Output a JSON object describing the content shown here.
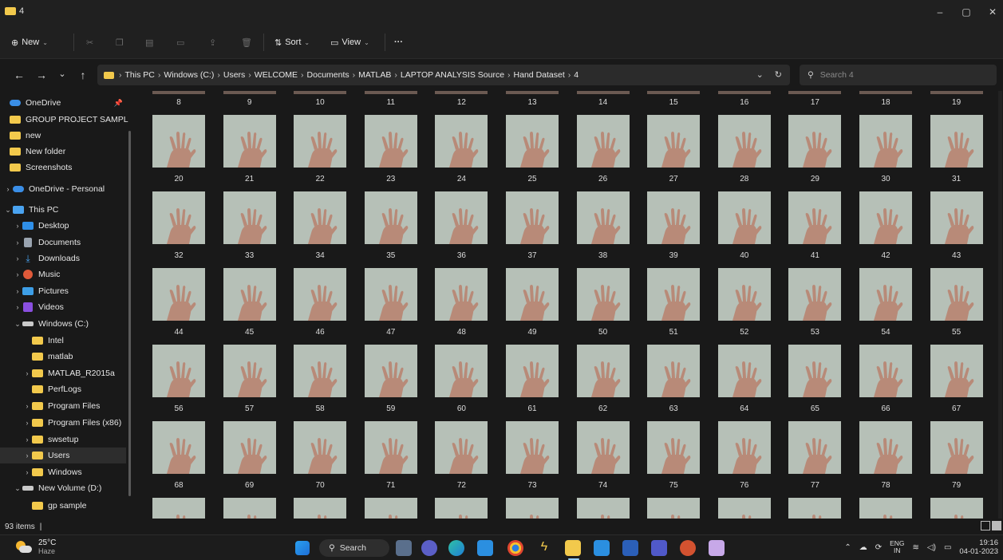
{
  "window": {
    "title": "4",
    "controls": {
      "minimize": "–",
      "restore": "▢",
      "close": "✕"
    }
  },
  "toolbar": {
    "new_label": "New",
    "sort_label": "Sort",
    "view_label": "View",
    "more_label": "···"
  },
  "address": {
    "crumbs": [
      "This PC",
      "Windows (C:)",
      "Users",
      "WELCOME",
      "Documents",
      "MATLAB",
      "LAPTOP ANALYSIS Source",
      "Hand Dataset",
      "4"
    ],
    "separator": "›"
  },
  "search": {
    "placeholder": "Search 4"
  },
  "sidebar": {
    "items": [
      {
        "label": "OneDrive",
        "icon": "cloud-icon",
        "indent": 0,
        "chevron": "",
        "pinned": true
      },
      {
        "label": "GROUP PROJECT SAMPL",
        "icon": "folder-icon",
        "indent": 0,
        "chevron": ""
      },
      {
        "label": "new",
        "icon": "folder-icon",
        "indent": 0,
        "chevron": ""
      },
      {
        "label": "New folder",
        "icon": "folder-icon",
        "indent": 0,
        "chevron": ""
      },
      {
        "label": "Screenshots",
        "icon": "folder-icon",
        "indent": 0,
        "chevron": ""
      },
      {
        "label": "OneDrive - Personal",
        "icon": "cloud-icon",
        "indent": 0,
        "chevron": "›"
      },
      {
        "label": "This PC",
        "icon": "pc-icon",
        "indent": 0,
        "chevron": "⌄"
      },
      {
        "label": "Desktop",
        "icon": "desktop-icon",
        "indent": 1,
        "chevron": "›"
      },
      {
        "label": "Documents",
        "icon": "documents-icon",
        "indent": 1,
        "chevron": "›"
      },
      {
        "label": "Downloads",
        "icon": "downloads-icon",
        "indent": 1,
        "chevron": "›"
      },
      {
        "label": "Music",
        "icon": "music-icon",
        "indent": 1,
        "chevron": "›"
      },
      {
        "label": "Pictures",
        "icon": "pictures-icon",
        "indent": 1,
        "chevron": "›"
      },
      {
        "label": "Videos",
        "icon": "videos-icon",
        "indent": 1,
        "chevron": "›"
      },
      {
        "label": "Windows (C:)",
        "icon": "drive-icon",
        "indent": 1,
        "chevron": "⌄"
      },
      {
        "label": "Intel",
        "icon": "folder-icon",
        "indent": 2,
        "chevron": ""
      },
      {
        "label": "matlab",
        "icon": "folder-icon",
        "indent": 2,
        "chevron": ""
      },
      {
        "label": "MATLAB_R2015a",
        "icon": "folder-icon",
        "indent": 2,
        "chevron": "›"
      },
      {
        "label": "PerfLogs",
        "icon": "folder-icon",
        "indent": 2,
        "chevron": ""
      },
      {
        "label": "Program Files",
        "icon": "folder-icon",
        "indent": 2,
        "chevron": "›"
      },
      {
        "label": "Program Files (x86)",
        "icon": "folder-icon",
        "indent": 2,
        "chevron": "›"
      },
      {
        "label": "swsetup",
        "icon": "folder-icon",
        "indent": 2,
        "chevron": "›"
      },
      {
        "label": "Users",
        "icon": "folder-icon",
        "indent": 2,
        "chevron": "›",
        "selected": true
      },
      {
        "label": "Windows",
        "icon": "folder-icon",
        "indent": 2,
        "chevron": "›"
      },
      {
        "label": "New Volume (D:)",
        "icon": "drive-icon",
        "indent": 1,
        "chevron": "⌄"
      },
      {
        "label": "gp sample",
        "icon": "folder-icon",
        "indent": 2,
        "chevron": ""
      }
    ]
  },
  "files": {
    "first_row_labels": [
      "8",
      "9",
      "10",
      "11",
      "12",
      "13",
      "14",
      "15",
      "16",
      "17",
      "18",
      "19"
    ],
    "rows": [
      [
        "20",
        "21",
        "22",
        "23",
        "24",
        "25",
        "26",
        "27",
        "28",
        "29",
        "30",
        "31"
      ],
      [
        "32",
        "33",
        "34",
        "35",
        "36",
        "37",
        "38",
        "39",
        "40",
        "41",
        "42",
        "43"
      ],
      [
        "44",
        "45",
        "46",
        "47",
        "48",
        "49",
        "50",
        "51",
        "52",
        "53",
        "54",
        "55"
      ],
      [
        "56",
        "57",
        "58",
        "59",
        "60",
        "61",
        "62",
        "63",
        "64",
        "65",
        "66",
        "67"
      ],
      [
        "68",
        "69",
        "70",
        "71",
        "72",
        "73",
        "74",
        "75",
        "76",
        "77",
        "78",
        "79"
      ]
    ]
  },
  "status": {
    "item_count": "93 items",
    "divider": "|"
  },
  "taskbar": {
    "weather_temp": "25°C",
    "weather_desc": "Haze",
    "search_label": "Search",
    "lang_top": "ENG",
    "lang_bottom": "IN",
    "time": "19:16",
    "date": "04-01-2023"
  },
  "colors": {
    "accent": "#4aa3f0",
    "folder": "#f2c94c",
    "thumb_bg": "#b6c0b7",
    "hand": "#b88a78"
  }
}
